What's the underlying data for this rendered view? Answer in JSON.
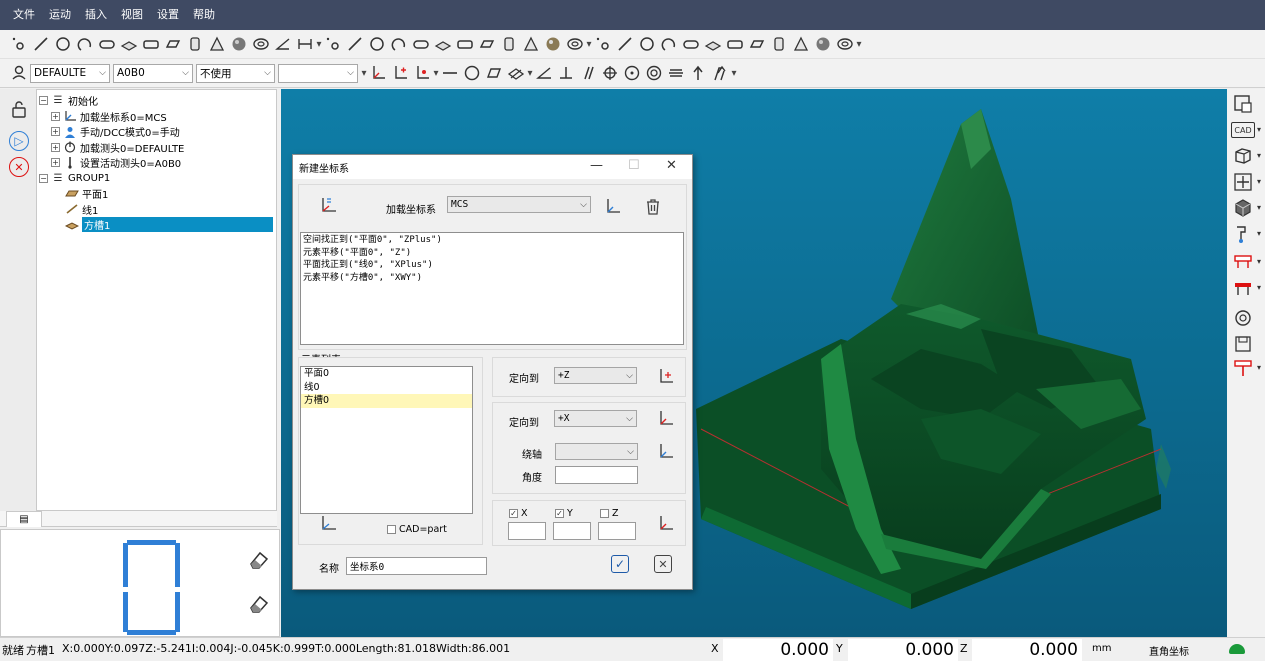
{
  "menu": [
    "文件",
    "运动",
    "插入",
    "视图",
    "设置",
    "帮助"
  ],
  "toolbar2": {
    "probe_combo": "DEFAULTE",
    "tip_combo": "A0B0",
    "mode_combo": "不使用",
    "extra_combo": ""
  },
  "tree": {
    "root": "初始化",
    "init_children": [
      "加载坐标系0=MCS",
      "手动/DCC模式0=手动",
      "加载测头0=DEFAULTE",
      "设置活动测头0=A0B0"
    ],
    "group": "GROUP1",
    "group_children": [
      "平面1",
      "线1",
      "方槽1"
    ]
  },
  "dialog": {
    "title": "新建坐标系",
    "load_cs_label": "加载坐标系",
    "load_cs_value": "MCS",
    "script_lines": [
      "空间找正到(\"平面0\", \"ZPlus\")",
      "元素平移(\"平面0\", \"Z\")",
      "平面找正到(\"线0\", \"XPlus\")",
      "元素平移(\"方槽0\", \"XWY\")"
    ],
    "element_list_label": "元素列表",
    "elements": [
      "平面0",
      "线0",
      "方槽0"
    ],
    "orient_label_1": "定向到",
    "orient_value_1": "+Z",
    "orient_label_2": "定向到",
    "orient_value_2": "+X",
    "axis_label": "绕轴",
    "axis_value": "",
    "angle_label": "角度",
    "angle_value": "",
    "cad_part_label": "CAD=part",
    "x_label": "X",
    "y_label": "Y",
    "z_label": "Z",
    "name_label": "名称",
    "name_value": "坐标系0"
  },
  "status": {
    "ready": "就绪",
    "element": "方槽1",
    "info": "X:0.000Y:0.097Z:-5.241I:0.004J:-0.045K:0.999T:0.000Length:81.018Width:86.001",
    "x_label": "X",
    "x_value": "0.000",
    "y_label": "Y",
    "y_value": "0.000",
    "z_label": "Z",
    "z_value": "0.000",
    "unit": "mm",
    "coord_mode": "直角坐标"
  },
  "colors": {
    "menubar": "#3f4a63",
    "viewport": "#0f7ea8",
    "model": "#0f5a2c",
    "selection": "#0a8fc4",
    "seven_segment": "#2f7fd6"
  }
}
